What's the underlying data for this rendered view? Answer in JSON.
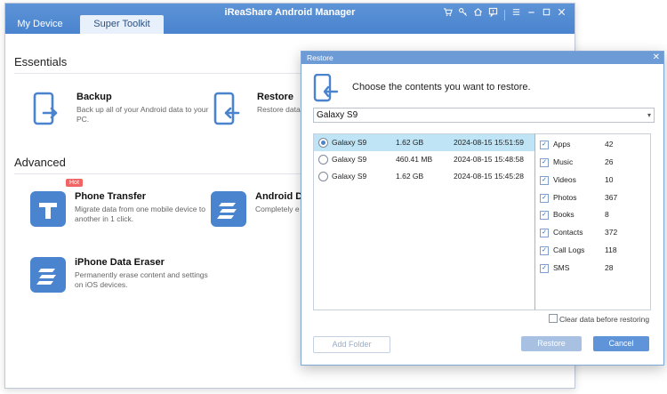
{
  "app": {
    "title": "iReaShare Android Manager",
    "tabs": [
      "My Device",
      "Super Toolkit"
    ]
  },
  "essentials": {
    "heading": "Essentials",
    "tools": [
      {
        "title": "Backup",
        "desc": "Back up all of your Android data to your PC."
      },
      {
        "title": "Restore",
        "desc": "Restore data backup."
      }
    ]
  },
  "advanced": {
    "heading": "Advanced",
    "tools": [
      {
        "title": "Phone Transfer",
        "desc": "Migrate data from one mobile device to another in 1 click.",
        "badge": "Hot"
      },
      {
        "title": "Android Da",
        "desc": "Completely e settings on A"
      },
      {
        "title": "iPhone Data Eraser",
        "desc": "Permanently erase content and settings on iOS devices."
      }
    ]
  },
  "dialog": {
    "title": "Restore",
    "heading": "Choose the contents you want to restore.",
    "device_select": "Galaxy S9",
    "backups": [
      {
        "device": "Galaxy S9",
        "size": "1.62 GB",
        "date": "2024-08-15 15:51:59",
        "selected": true
      },
      {
        "device": "Galaxy S9",
        "size": "460.41 MB",
        "date": "2024-08-15 15:48:58",
        "selected": false
      },
      {
        "device": "Galaxy S9",
        "size": "1.62 GB",
        "date": "2024-08-15 15:45:28",
        "selected": false
      }
    ],
    "categories": [
      {
        "label": "Apps",
        "count": "42"
      },
      {
        "label": "Music",
        "count": "26"
      },
      {
        "label": "Videos",
        "count": "10"
      },
      {
        "label": "Photos",
        "count": "367"
      },
      {
        "label": "Books",
        "count": "8"
      },
      {
        "label": "Contacts",
        "count": "372"
      },
      {
        "label": "Call Logs",
        "count": "118"
      },
      {
        "label": "SMS",
        "count": "28"
      }
    ],
    "clear_option": "Clear data before restoring",
    "buttons": {
      "add_folder": "Add Folder",
      "restore": "Restore",
      "cancel": "Cancel"
    }
  },
  "colors": {
    "accent": "#4a84cf",
    "titlebar": "#5d93d6",
    "hot": "#f26363"
  }
}
